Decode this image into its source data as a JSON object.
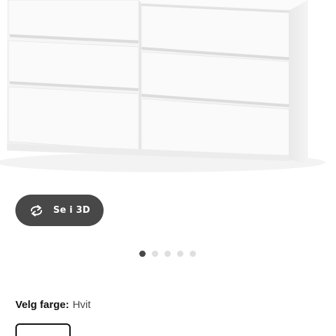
{
  "gallery": {
    "image_alt": "",
    "view3d": {
      "label": "Se i 3D",
      "icon": "rotate-3d-icon"
    },
    "page_count": 5,
    "active_page": 1
  },
  "color": {
    "label": "Velg farge:",
    "selected": "Hvit",
    "swatch_icon": "white-swatch"
  },
  "colors": {
    "accent_dark": "#484848",
    "dot_inactive": "#dfdfdf",
    "text": "#111111"
  }
}
